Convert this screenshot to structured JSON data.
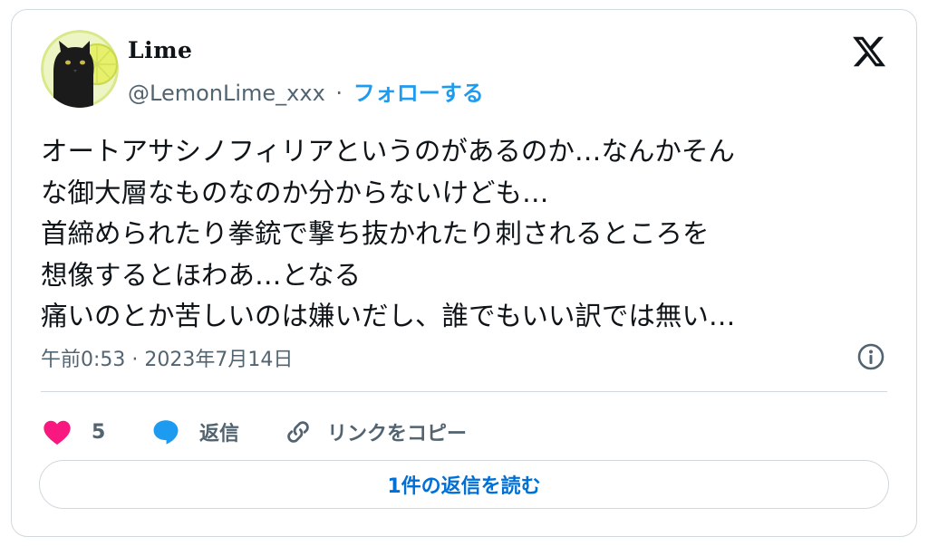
{
  "author": {
    "display_name": "Lime",
    "handle": "@LemonLime_xxx",
    "separator": "·",
    "follow_label": "フォローする"
  },
  "tweet": {
    "lines": [
      "オートアサシノフィリアというのがあるのか…なんかそん",
      "な御大層なものなのか分からないけども…",
      "首締められたり拳銃で撃ち抜かれたり刺されるところを",
      "想像するとほわあ…となる",
      "痛いのとか苦しいのは嫌いだし、誰でもいい訳では無い…"
    ],
    "timestamp": "午前0:53 · 2023年7月14日"
  },
  "actions": {
    "like_count": "5",
    "reply_label": "返信",
    "copy_link_label": "リンクをコピー"
  },
  "read_replies_label": "1件の返信を読む",
  "colors": {
    "accent": "#1d9bf0",
    "like": "#f91880",
    "reply_icon": "#1d9bf0",
    "muted": "#536471",
    "border": "#cfd9de"
  },
  "icons": {
    "brand": "x-logo-icon",
    "info": "info-icon",
    "like": "heart-icon",
    "reply": "speech-bubble-icon",
    "copy_link": "link-icon"
  }
}
